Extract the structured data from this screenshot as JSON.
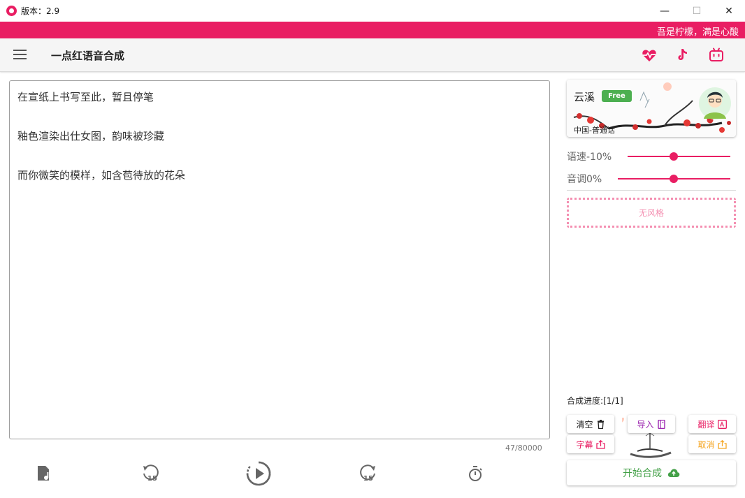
{
  "window": {
    "title": "版本：2.9",
    "minimize_glyph": "—",
    "maximize_glyph": "☐",
    "close_glyph": "✕"
  },
  "banner": {
    "text": "吾是柠檬，满是心酸"
  },
  "appbar": {
    "title": "一点红语音合成",
    "icons": [
      "menu-icon",
      "heartbeat-icon",
      "tiktok-icon",
      "bilibili-icon"
    ]
  },
  "editor": {
    "lines": [
      "在宣纸上书写至此，暂且停笔",
      "釉色渲染出仕女图，韵味被珍藏",
      "而你微笑的模样，如含苞待放的花朵"
    ],
    "char_count": "47/80000"
  },
  "player": {
    "icons": [
      "music-file-icon",
      "rewind-15-icon",
      "play-icon",
      "forward-15-icon",
      "timer-icon"
    ],
    "skip_seconds": "15"
  },
  "voice": {
    "name": "云溪",
    "badge": "Free",
    "locale": "中国-普通话"
  },
  "speed": {
    "label": "语速-10%",
    "level": 0.5
  },
  "pitch": {
    "label": "音调0%",
    "level": 0.5
  },
  "style": {
    "label": "无风格"
  },
  "progress": {
    "text": "合成进度:[1/1]"
  },
  "buttons": {
    "clear": "清空",
    "import": "导入",
    "translate": "翻译",
    "subtitle": "字幕",
    "cancel": "取消",
    "start": "开始合成"
  },
  "colors": {
    "accent": "#e91e63",
    "accent_light": "#f48fb1",
    "green": "#43a047",
    "purple": "#9c27b0",
    "orange": "#f5a623"
  }
}
